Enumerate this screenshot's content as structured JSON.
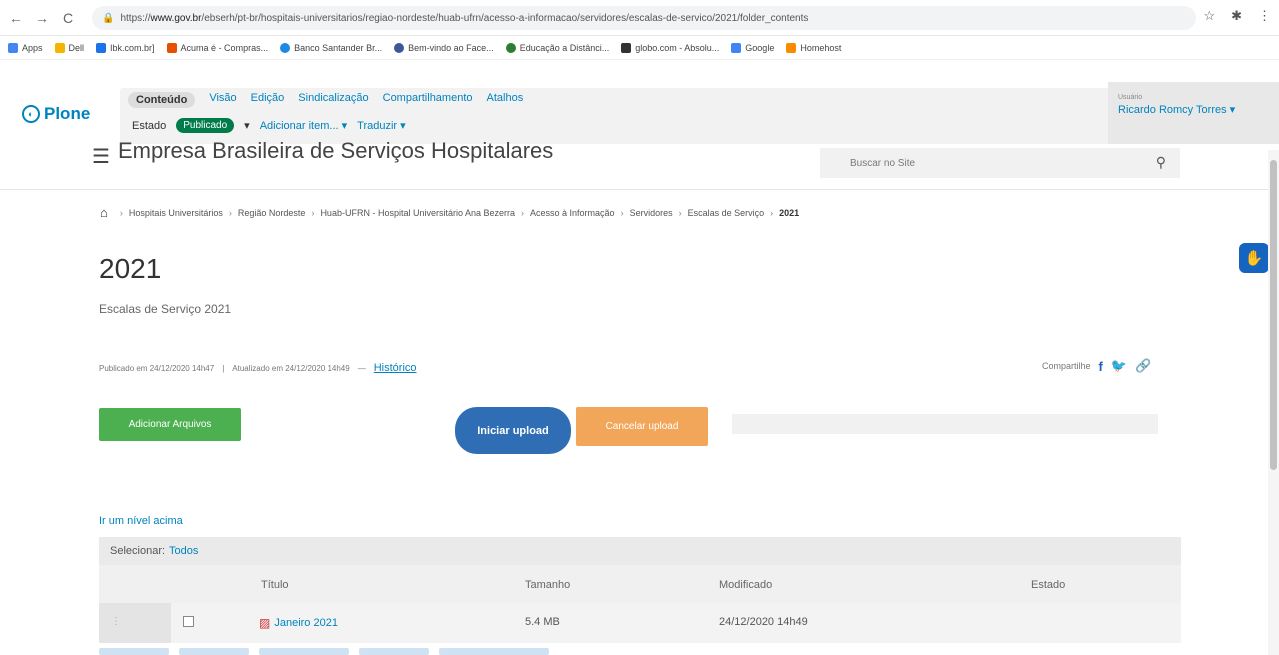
{
  "browser": {
    "url_prefix": "https://",
    "url_host": "www.gov.br",
    "url_path": "/ebserh/pt-br/hospitais-universitarios/regiao-nordeste/huab-ufrn/acesso-a-informacao/servidores/escalas-de-servico/2021/folder_contents",
    "bookmarks": [
      "Apps",
      "Dell",
      "Ibk.com.br]",
      "Acuma é - Compras...",
      "Banco Santander Br...",
      "Bem-vindo ao Face...",
      "Educação a Distânci...",
      "globo.com - Absolu...",
      "Google",
      "Homehost"
    ]
  },
  "plone": {
    "logo": "Plone",
    "menu": [
      "Conteúdo",
      "Visão",
      "Edição",
      "Sindicalização",
      "Compartilhamento",
      "Atalhos"
    ],
    "state_label": "Estado",
    "state_value": "Publicado",
    "add_item": "Adicionar item...",
    "translate": "Traduzir",
    "user_small": "Usuário",
    "user_name": "Ricardo Romcy Torres"
  },
  "site": {
    "title": "Empresa Brasileira de Serviços Hospitalares",
    "search_placeholder": "Buscar no Site"
  },
  "breadcrumb": [
    "Hospitais Universitários",
    "Região Nordeste",
    "Huab-UFRN - Hospital Universitário Ana Bezerra",
    "Acesso à Informação",
    "Servidores",
    "Escalas de Serviço",
    "2021"
  ],
  "page": {
    "title": "2021",
    "description": "Escalas de Serviço 2021",
    "published": "Publicado em 24/12/2020 14h47",
    "updated": "Atualizado em 24/12/2020 14h49",
    "history_link": "Histórico",
    "share_label": "Compartilhe"
  },
  "upload": {
    "add_files": "Adicionar Arquivos",
    "start_upload": "Iniciar upload",
    "cancel_upload": "Cancelar upload"
  },
  "listing": {
    "up_level": "Ir um nível acima",
    "select_label": "Selecionar:",
    "select_all": "Todos",
    "columns": {
      "title": "Título",
      "size": "Tamanho",
      "modified": "Modificado",
      "state": "Estado"
    },
    "rows": [
      {
        "title": "Janeiro 2021",
        "size": "5.4 MB",
        "modified": "24/12/2020 14h49"
      }
    ]
  }
}
